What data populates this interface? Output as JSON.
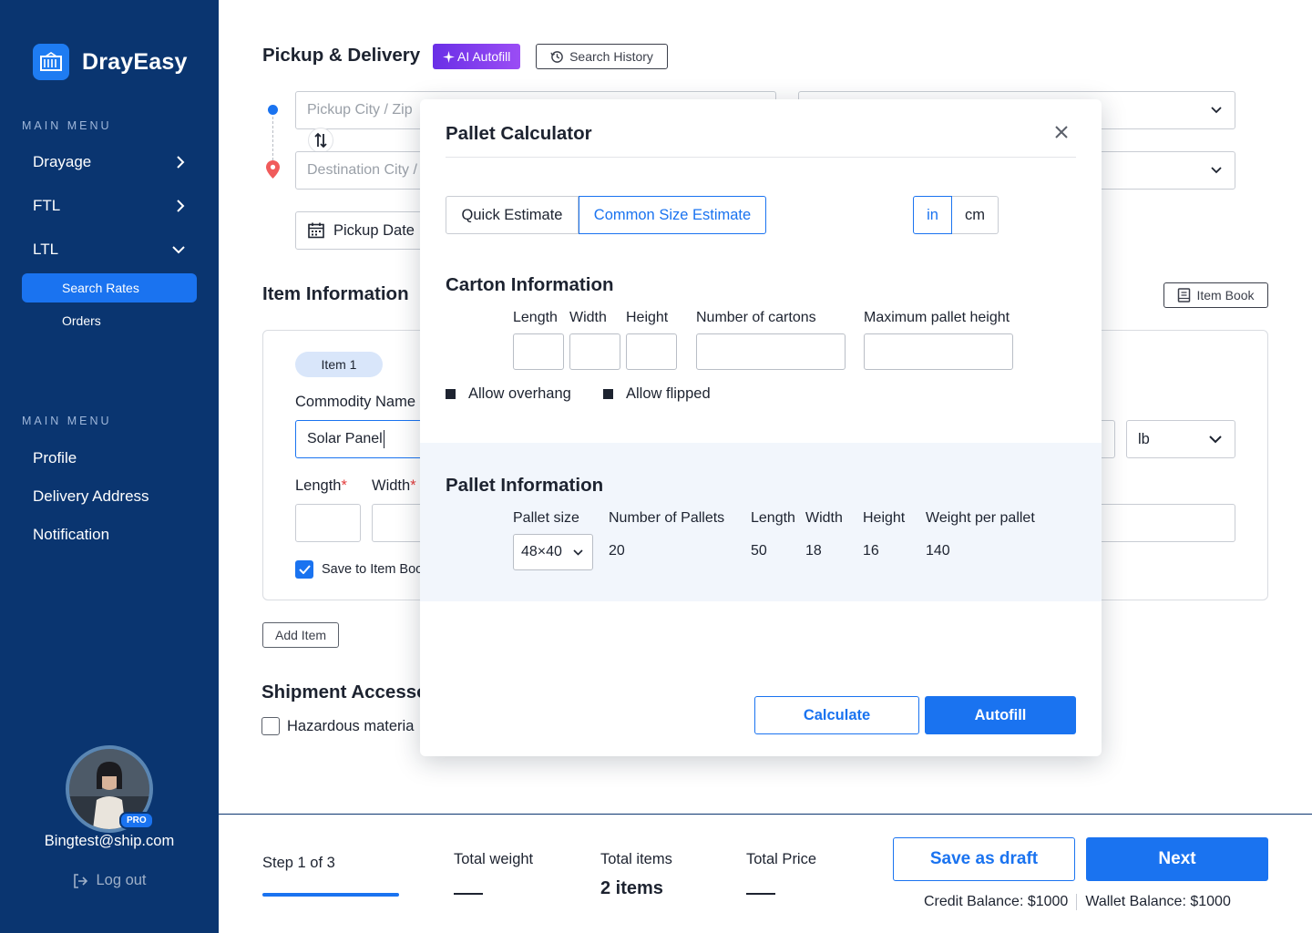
{
  "brand": {
    "name": "DrayEasy",
    "accent": "#1a73f0",
    "sidebar_bg": "#0a3570"
  },
  "sidebar": {
    "menu1_heading": "MAIN MENU",
    "nav": [
      {
        "label": "Drayage",
        "icon": "chevron-right-icon"
      },
      {
        "label": "FTL",
        "icon": "chevron-right-icon"
      },
      {
        "label": "LTL",
        "icon": "chevron-down-icon"
      }
    ],
    "ltl_sub": [
      {
        "label": "Search Rates",
        "active": true
      },
      {
        "label": "Orders",
        "active": false
      }
    ],
    "menu2_heading": "MAIN MENU",
    "nav2": [
      {
        "label": "Profile"
      },
      {
        "label": "Delivery Address"
      },
      {
        "label": "Notification"
      }
    ],
    "user": {
      "email": "Bingtest@ship.com",
      "badge": "PRO"
    },
    "logout": "Log out"
  },
  "main": {
    "pickup_title": "Pickup & Delivery",
    "ai_autofill": "AI Autofill",
    "search_history": "Search History",
    "pickup_placeholder": "Pickup City / Zip",
    "destination_placeholder": "Destination City /",
    "pickup_date": "Pickup Date",
    "item_info_title": "Item Information",
    "item_book": "Item Book",
    "item_tab": "Item 1",
    "commodity_label": "Commodity Name",
    "commodity_value": "Solar Panel",
    "weight_unit": "lb",
    "length_label": "Length",
    "width_label": "Width",
    "required_mark": "*",
    "save_to_item_book": "Save to Item Boo",
    "add_item": "Add Item",
    "accessorials_title": "Shipment Accesso",
    "hazardous": "Hazardous materia"
  },
  "footer": {
    "step": "Step 1 of 3",
    "step_progress": 0.333,
    "total_weight_label": "Total weight",
    "total_weight_value": "",
    "total_items_label": "Total items",
    "total_items_value": "2 items",
    "total_price_label": "Total Price",
    "total_price_value": "",
    "save_draft": "Save as draft",
    "next": "Next",
    "credit_balance": "Credit Balance: $1000",
    "wallet_balance": "Wallet Balance: $1000"
  },
  "modal": {
    "title": "Pallet Calculator",
    "tabs": [
      {
        "label": "Quick Estimate",
        "selected": false
      },
      {
        "label": "Common Size Estimate",
        "selected": true
      }
    ],
    "units": [
      {
        "label": "in",
        "selected": true
      },
      {
        "label": "cm",
        "selected": false
      }
    ],
    "carton_title": "Carton Information",
    "carton_fields": {
      "length": "Length",
      "width": "Width",
      "height": "Height",
      "count": "Number of cartons",
      "max_height": "Maximum pallet height"
    },
    "allow_overhang": "Allow overhang",
    "allow_flipped": "Allow flipped",
    "pallet_title": "Pallet Information",
    "pallet_headers": {
      "size": "Pallet size",
      "count": "Number of Pallets",
      "length": "Length",
      "width": "Width",
      "height": "Height",
      "weight": "Weight per pallet"
    },
    "pallet_values": {
      "size": "48×40",
      "count": "20",
      "length": "50",
      "width": "18",
      "height": "16",
      "weight": "140"
    },
    "calculate": "Calculate",
    "autofill": "Autofill"
  }
}
